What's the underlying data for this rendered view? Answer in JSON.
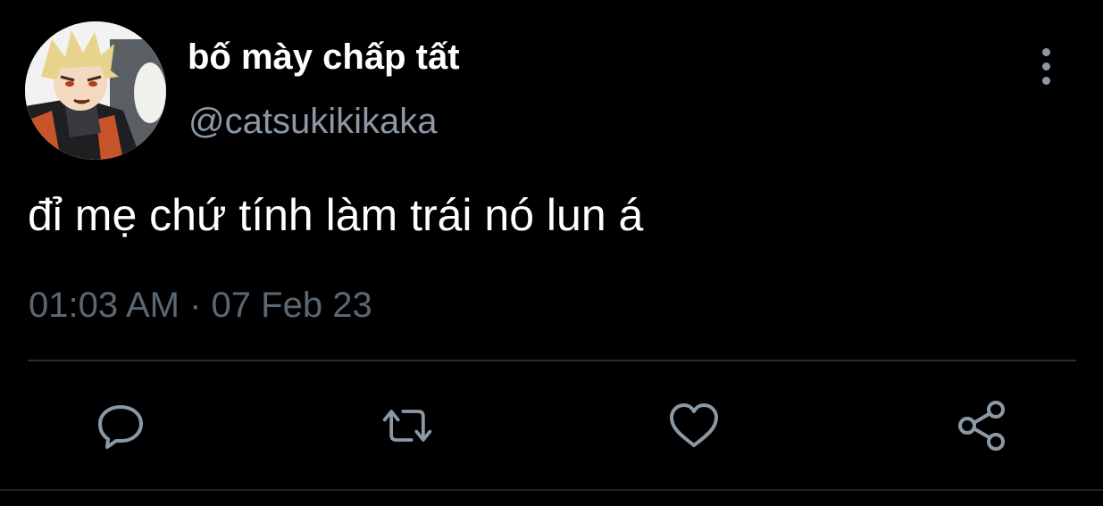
{
  "tweet": {
    "display_name": "bố mày chấp tất",
    "handle": "@catsukikikaka",
    "text": "đỉ mẹ chứ tính làm trái nó lun á",
    "timestamp": "01:03 AM · 07 Feb 23"
  },
  "icons": {
    "more": "more-vertical-icon",
    "reply": "reply-bubble-icon",
    "retweet": "retweet-icon",
    "like": "heart-icon",
    "share": "share-nodes-icon"
  },
  "colors": {
    "background": "#000000",
    "text_primary": "#ffffff",
    "text_secondary": "#8b98a5",
    "timestamp": "#5b6773",
    "icon": "#8b98a5",
    "divider": "#2a2f34"
  }
}
